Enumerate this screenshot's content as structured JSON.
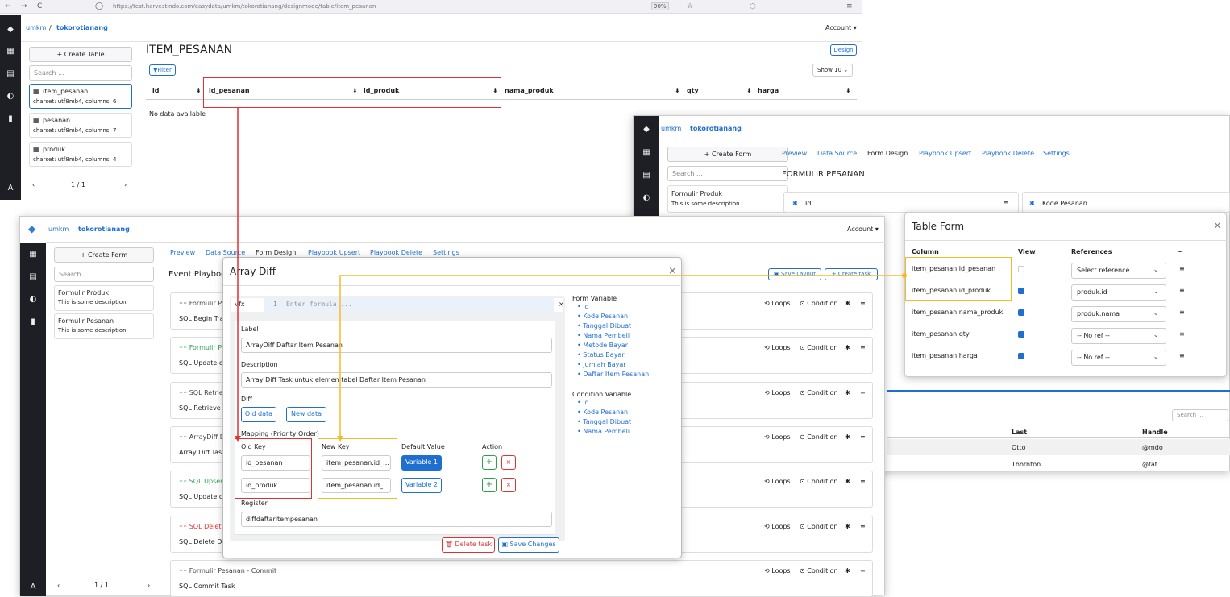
{
  "browser": {
    "url": "https://test.harvestindo.com/easydata/umkm/tokorotianang/designmode/table/item_pesanan",
    "zoom": "90%"
  },
  "back": {
    "brand": "umkm",
    "sep": "/",
    "project": "tokorotianang",
    "account": "Account ▾",
    "create_table": "+ Create Table",
    "search_placeholder": "Search ...",
    "tables": [
      {
        "name": "item_pesanan",
        "meta": "charset: utf8mb4, columns: 6"
      },
      {
        "name": "pesanan",
        "meta": "charset: utf8mb4, columns: 7"
      },
      {
        "name": "produk",
        "meta": "charset: utf8mb4, columns: 4"
      }
    ],
    "pager": "1 / 1",
    "title": "ITEM_PESANAN",
    "design": "Design",
    "filter": "Filter",
    "show": "Show 10",
    "columns": [
      "id",
      "id_pesanan",
      "id_produk",
      "nama_produk",
      "qty",
      "harga"
    ],
    "empty": "No data available"
  },
  "right": {
    "brand": "umkm",
    "project": "tokorotianang",
    "create_form": "+ Create Form",
    "search_placeholder": "Search ...",
    "tabs": [
      "Preview",
      "Data Source",
      "Form Design",
      "Playbook Upsert",
      "Playbook Delete",
      "Settings"
    ],
    "title": "FORMULIR PESANAN",
    "form_item": "Formulir Produk",
    "form_desc": "This is some description",
    "field1": "Id",
    "field2": "Kode Pesanan",
    "search2": "Search ...",
    "t_head": [
      "Last",
      "Handle"
    ],
    "t_rows": [
      [
        "Otto",
        "@mdo"
      ],
      [
        "Thornton",
        "@fat"
      ]
    ]
  },
  "table_form": {
    "title": "Table Form",
    "headers": [
      "Column",
      "View",
      "References",
      "~"
    ],
    "rows": [
      {
        "col": "item_pesanan.id_pesanan",
        "view": false,
        "ref": "Select reference"
      },
      {
        "col": "item_pesanan.id_produk",
        "view": true,
        "ref": "produk.id"
      },
      {
        "col": "item_pesanan.nama_produk",
        "view": true,
        "ref": "produk.nama"
      },
      {
        "col": "item_pesanan.qty",
        "view": true,
        "ref": "-- No ref --"
      },
      {
        "col": "item_pesanan.harga",
        "view": true,
        "ref": "-- No ref --"
      }
    ]
  },
  "front": {
    "brand": "umkm",
    "project": "tokorotianang",
    "account": "Account ▾",
    "create_form": "+ Create Form",
    "search_placeholder": "Search ...",
    "forms": [
      {
        "name": "Formulir Produk",
        "desc": "This is some description"
      },
      {
        "name": "Formulir Pesanan",
        "desc": "This is some description"
      }
    ],
    "pager": "1 / 1",
    "tabs": [
      "Preview",
      "Data Source",
      "Form Design",
      "Playbook Upsert",
      "Playbook Delete",
      "Settings"
    ],
    "heading": "Event Playbook",
    "save_layout": "Save Layout",
    "create_task": "+ Create task",
    "tasks": [
      {
        "t": "···· Formulir Pesanan",
        "s": "SQL Begin Transaction"
      },
      {
        "t": "···· Formulir Pesanan",
        "s": "SQL Update or Insert"
      },
      {
        "t": "···· SQL Retrieve",
        "s": "SQL Retrieve Column"
      },
      {
        "t": "···· ArrayDiff Daftar",
        "s": "Array Diff Task"
      },
      {
        "t": "···· SQL Upsert",
        "s": "SQL Update or Insert"
      },
      {
        "t": "···· SQL Delete",
        "s": "SQL Delete Data"
      },
      {
        "t": "···· Formulir Pesanan - Commit",
        "s": "SQL Commit Task"
      }
    ],
    "loops": "Loops",
    "condition": "Condition"
  },
  "modal": {
    "title": "Array Diff",
    "fx": "√fx",
    "line": "1",
    "formula_ph": "Enter formula ...",
    "label_lbl": "Label",
    "label_val": "ArrayDiff Daftar Item Pesanan",
    "desc_lbl": "Description",
    "desc_val": "Array Diff Task untuk elemen tabel Daftar Item Pesanan",
    "diff_lbl": "Diff",
    "old_data": "Old data",
    "new_data": "New data",
    "mapping": "Mapping (Priority Order)",
    "h_old": "Old Key",
    "h_new": "New Key",
    "h_def": "Default Value",
    "h_act": "Action",
    "rows": [
      {
        "old": "id_pesanan",
        "new": "item_pesanan.id_pesanan",
        "var": "Variable 1"
      },
      {
        "old": "id_produk",
        "new": "item_pesanan.id_produk",
        "var": "Variable 2"
      }
    ],
    "reg_lbl": "Register",
    "reg_val": "diffdaftaritempesanan",
    "delete": "Delete task",
    "save": "Save Changes",
    "fv_title": "Form Variable",
    "fv": [
      "Id",
      "Kode Pesanan",
      "Tanggal Dibuat",
      "Nama Pembeli",
      "Metode Bayar",
      "Status Bayar",
      "Jumlah Bayar",
      "Daftar Item Pesanan"
    ],
    "cv_title": "Condition Variable",
    "cv": [
      "Id",
      "Kode Pesanan",
      "Tanggal Dibuat",
      "Nama Pembeli"
    ]
  },
  "colors": {
    "accent": "#1f6fd1",
    "red": "#e03030",
    "yellow": "#f2bb2c",
    "dark": "#1d1f24"
  }
}
